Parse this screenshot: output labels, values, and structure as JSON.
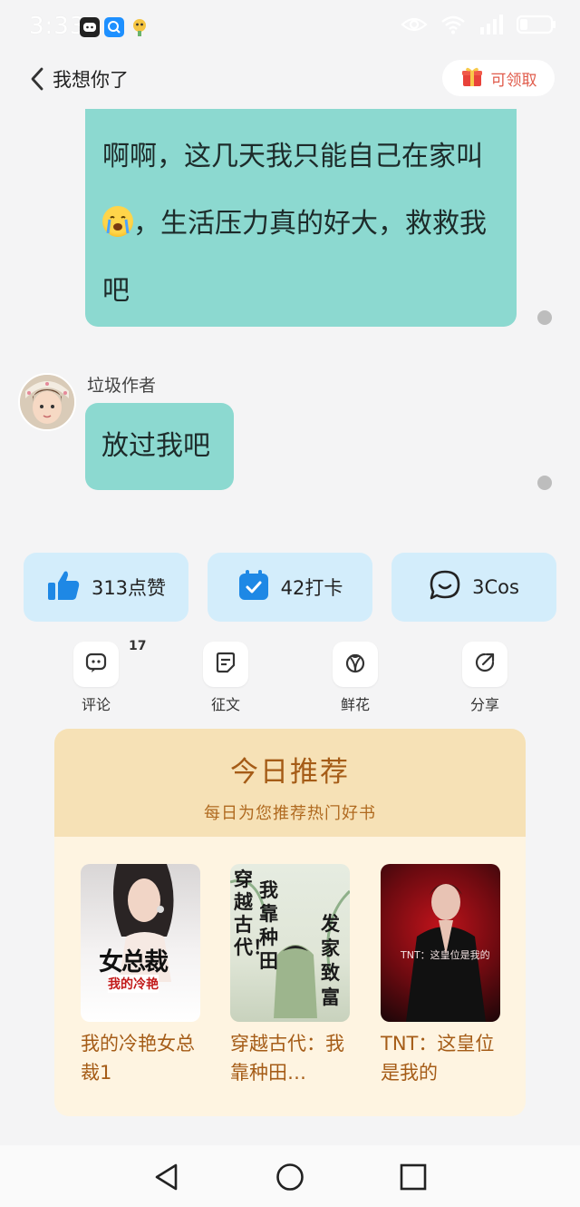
{
  "status_bar": {
    "time": "3:33",
    "icons": [
      "message-app-icon",
      "search-app-icon",
      "pet-app-icon",
      "eye-comfort-icon",
      "wifi-icon",
      "signal-icon",
      "battery-icon"
    ]
  },
  "header": {
    "title": "我想你了",
    "claim_label": "可领取",
    "claim_icon": "gift-box-icon"
  },
  "chat": {
    "message_1": {
      "text_before_emoji": "啊啊，这几天我只能自己在家叫",
      "emoji": "crying-face-emoji",
      "text_after_emoji": "，生活压力真的好大，救救我吧"
    },
    "sender_name": "垃圾作者",
    "message_2": "放过我吧"
  },
  "actions": {
    "like": {
      "icon": "thumbs-up-icon",
      "label": "313点赞"
    },
    "checkin": {
      "icon": "calendar-check-icon",
      "label": "42打卡"
    },
    "cos": {
      "icon": "chat-bubble-icon",
      "label": "3Cos"
    }
  },
  "tools": {
    "comment": {
      "label": "评论",
      "count": "17"
    },
    "essay": {
      "label": "征文"
    },
    "flower": {
      "label": "鲜花"
    },
    "share": {
      "label": "分享"
    }
  },
  "recommend": {
    "title": "今日推荐",
    "subtitle": "每日为您推荐热门好书",
    "books": [
      {
        "title": "我的冷艳女总裁1",
        "cover_text": "女总裁",
        "cover_sub": "我的冷艳"
      },
      {
        "title": "穿越古代：我靠种田…",
        "cover_text_left": "穿越古代！",
        "cover_text_mid": "我靠种田",
        "cover_text_right": "发家致富"
      },
      {
        "title": "TNT：这皇位是我的",
        "cover_text": "TNT：这皇位是我的"
      }
    ]
  },
  "colors": {
    "bubble": "#8cd9d0",
    "pill": "#d3edfb",
    "rec_header": "#f6e1b6",
    "rec_text": "#a55c17",
    "claim_text": "#e05b4b"
  },
  "nav": [
    "back-triangle-icon",
    "home-circle-icon",
    "recents-square-icon"
  ]
}
